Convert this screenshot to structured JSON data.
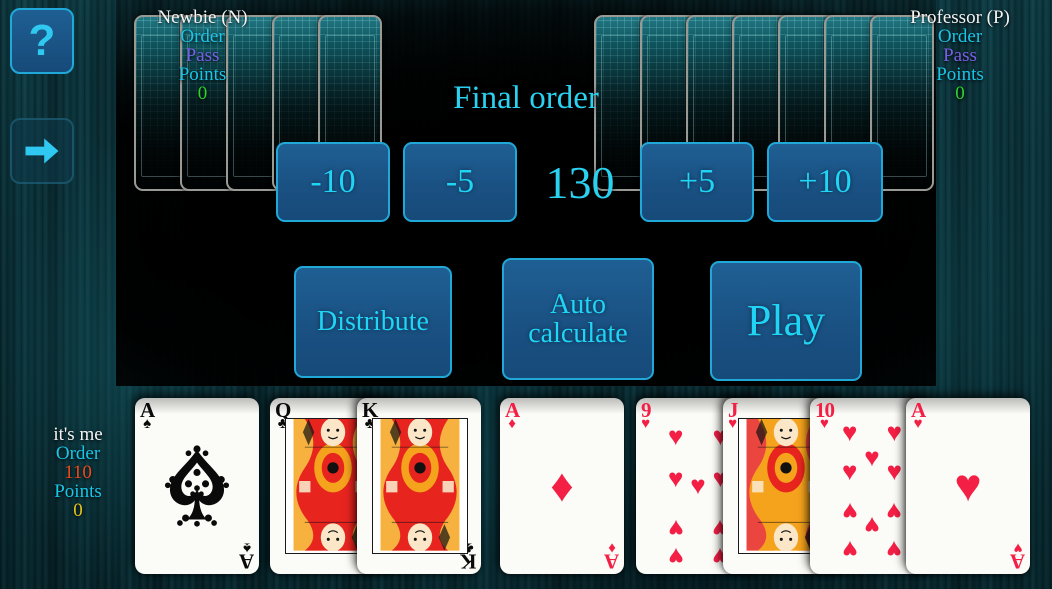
{
  "app": {
    "title": "Card Game - Final order phase"
  },
  "sidebar": {
    "help_label": "?",
    "help_name": "help-button",
    "next_label": "",
    "next_name": "next-arrow-button"
  },
  "center": {
    "phase_title": "Final order",
    "order_total": "130",
    "adjust_buttons": [
      {
        "label": "-10",
        "name": "order-minus-10-button"
      },
      {
        "label": "-5",
        "name": "order-minus-5-button"
      },
      {
        "label": "+5",
        "name": "order-plus-5-button"
      },
      {
        "label": "+10",
        "name": "order-plus-10-button"
      }
    ],
    "actions": [
      {
        "label": "Distribute",
        "name": "distribute-button"
      },
      {
        "label": "Auto\ncalculate",
        "name": "auto-calculate-button"
      },
      {
        "label": "Play",
        "name": "play-button"
      }
    ],
    "action_distribute": "Distribute",
    "action_auto_line1": "Auto",
    "action_auto_line2": "calculate",
    "action_play": "Play"
  },
  "players": [
    {
      "id": "newbie",
      "name": "Newbie (N)",
      "order_label": "Order",
      "order_value": "Pass",
      "order_value_kind": "pass",
      "points_label": "Points",
      "points_value": "0",
      "points_color": "#2ad62a",
      "hand_card_count": 5
    },
    {
      "id": "professor",
      "name": "Professor (P)",
      "order_label": "Order",
      "order_value": "Pass",
      "order_value_kind": "pass",
      "points_label": "Points",
      "points_value": "0",
      "points_color": "#2ad62a",
      "hand_card_count": 7
    },
    {
      "id": "me",
      "name": "it's me",
      "order_label": "Order",
      "order_value": "110",
      "order_value_kind": "number",
      "points_label": "Points",
      "points_value": "0",
      "points_color": "#e8c31a",
      "hand_card_count": 8
    }
  ],
  "hand": [
    {
      "rank": "A",
      "suit": "spades",
      "suit_glyph": "♠",
      "color": "black",
      "kind": "ace-spade-ornate"
    },
    {
      "rank": "Q",
      "suit": "clubs",
      "suit_glyph": "♣",
      "color": "black",
      "kind": "face-queen"
    },
    {
      "rank": "K",
      "suit": "clubs",
      "suit_glyph": "♣",
      "color": "black",
      "kind": "face-king"
    },
    {
      "rank": "A",
      "suit": "diamonds",
      "suit_glyph": "♦",
      "color": "red",
      "kind": "ace-simple"
    },
    {
      "rank": "9",
      "suit": "hearts",
      "suit_glyph": "♥",
      "color": "red",
      "kind": "pips-9"
    },
    {
      "rank": "J",
      "suit": "hearts",
      "suit_glyph": "♥",
      "color": "red",
      "kind": "face-jack"
    },
    {
      "rank": "10",
      "suit": "hearts",
      "suit_glyph": "♥",
      "color": "red",
      "kind": "pips-10"
    },
    {
      "rank": "A",
      "suit": "hearts",
      "suit_glyph": "♥",
      "color": "red",
      "kind": "ace-simple"
    }
  ],
  "colors": {
    "background_teal": "#0c3a43",
    "panel_black": "#000000",
    "accent_cyan": "#2ad2f2",
    "button_fill": "#1a5183",
    "button_border": "#1fa8d8",
    "label_cyan": "#19c6e8",
    "pass_purple": "#7a5fe8",
    "order_orange": "#ef4b1c",
    "points_green": "#2ad62a",
    "points_yellow": "#e8c31a",
    "card_face": "#fbfbf7",
    "suit_red": "#f41f45",
    "suit_black": "#0a0a0a",
    "card_back_teal": "#0e5e69",
    "card_back_border": "#9a9a95"
  }
}
